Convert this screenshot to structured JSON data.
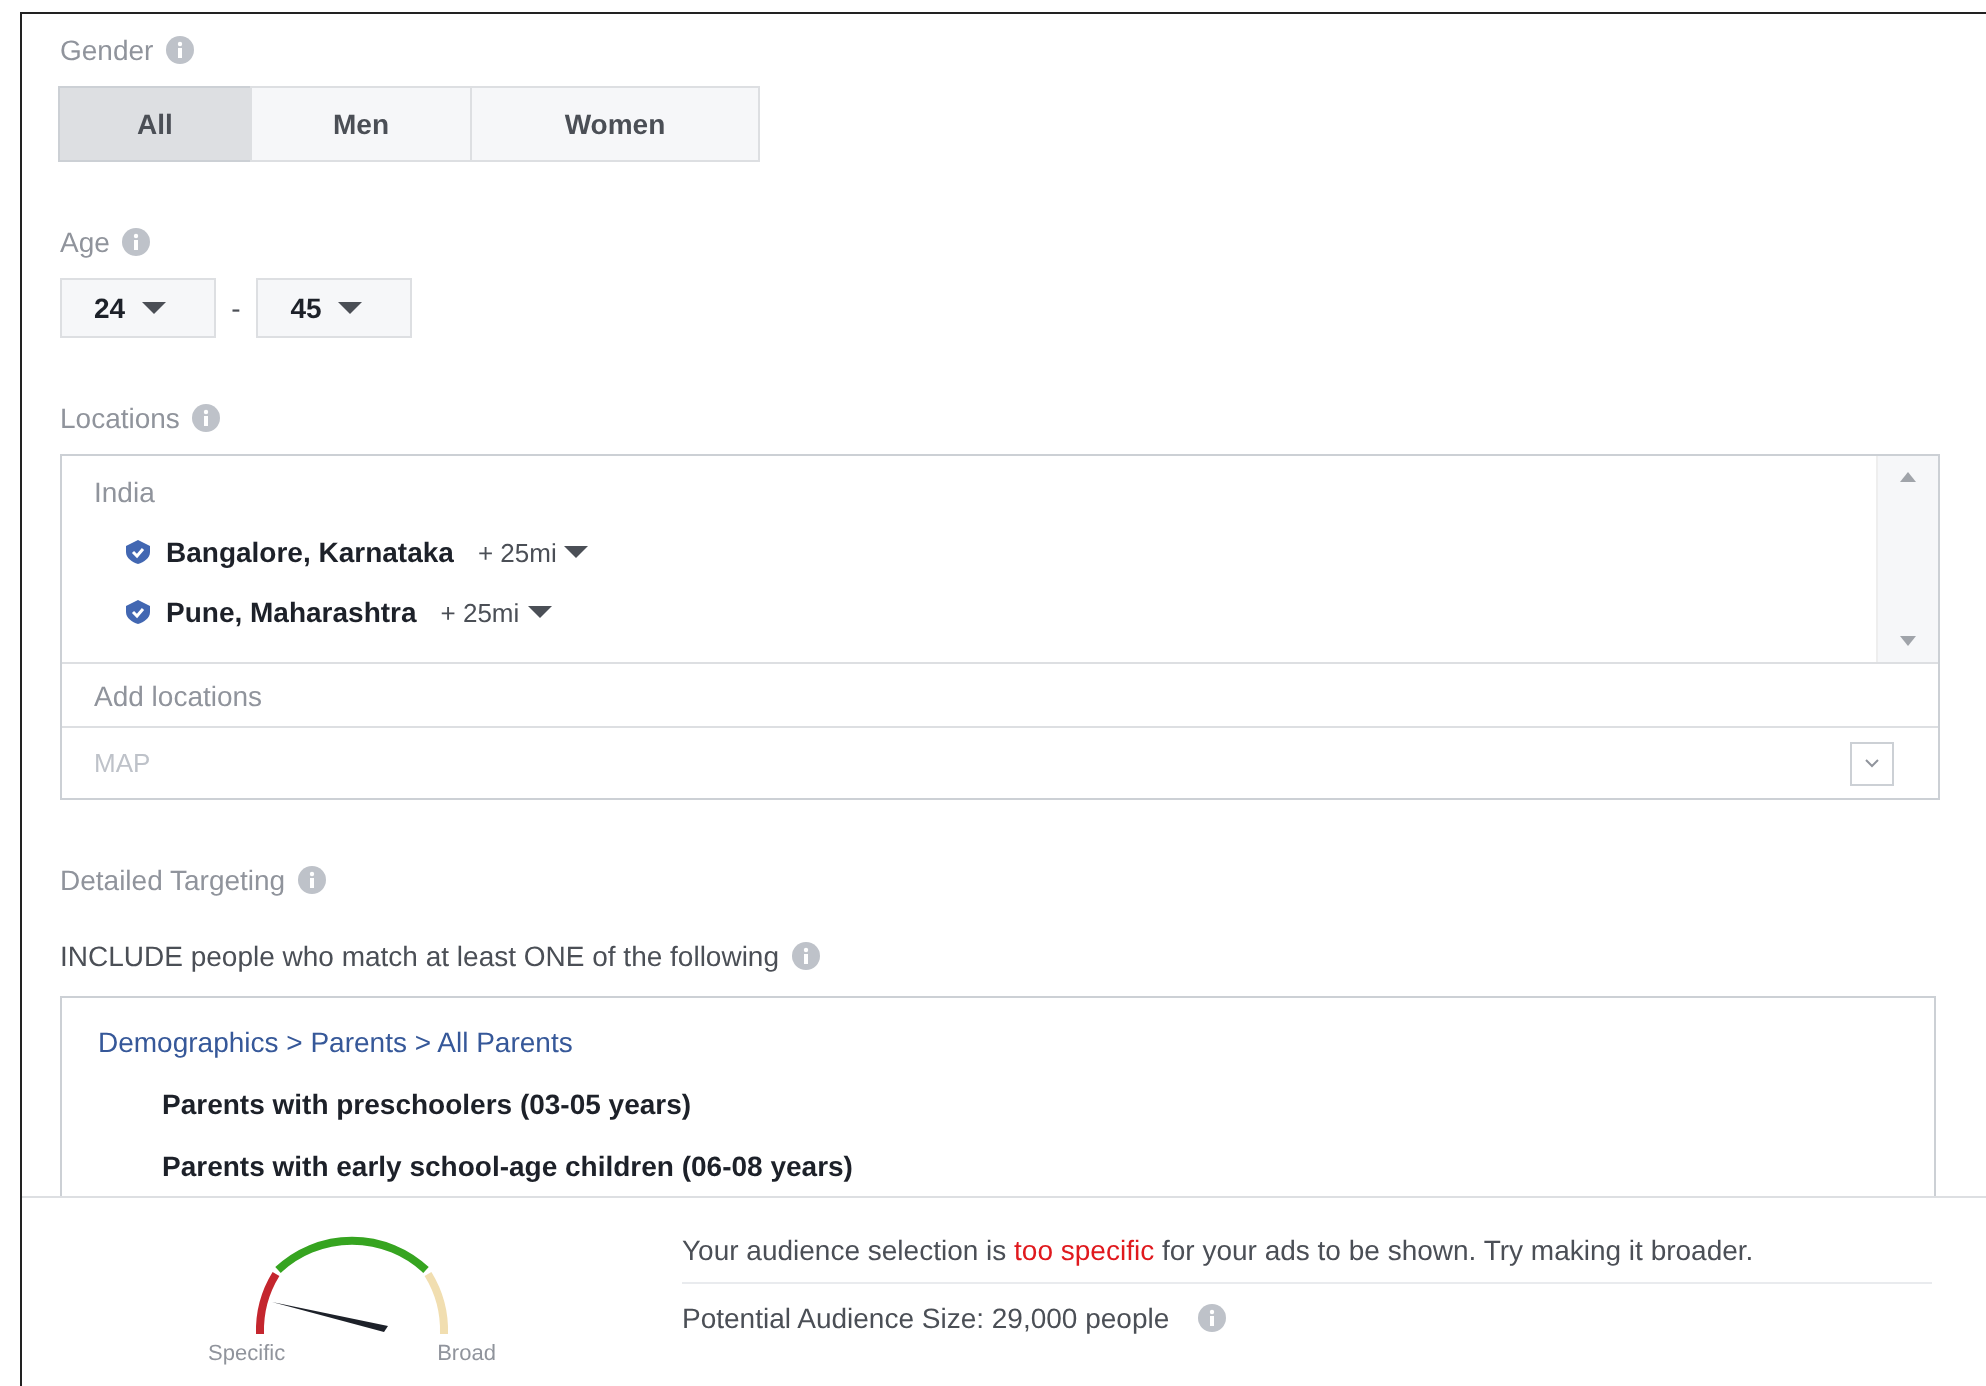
{
  "gender": {
    "label": "Gender",
    "options": [
      {
        "label": "All",
        "selected": true
      },
      {
        "label": "Men",
        "selected": false
      },
      {
        "label": "Women",
        "selected": false
      }
    ]
  },
  "age": {
    "label": "Age",
    "min": "24",
    "separator": "-",
    "max": "45"
  },
  "locations": {
    "label": "Locations",
    "country": "India",
    "items": [
      {
        "name": "Bangalore, Karnataka",
        "radius": "+ 25mi"
      },
      {
        "name": "Pune, Maharashtra",
        "radius": "+ 25mi"
      }
    ],
    "placeholder": "Add locations",
    "map_label": "MAP"
  },
  "detailed_targeting": {
    "label": "Detailed Targeting",
    "include_label": "INCLUDE people who match at least ONE of the following",
    "breadcrumb": "Demographics > Parents > All Parents",
    "items": [
      "Parents with preschoolers (03-05 years)",
      "Parents with early school-age children (06-08 years)"
    ]
  },
  "audience": {
    "specific_label": "Specific",
    "broad_label": "Broad",
    "message": "Your audience selection is **too specific** for your ads to be shown. Try making it broader.",
    "size": "Potential Audience Size: 29,000 people"
  }
}
